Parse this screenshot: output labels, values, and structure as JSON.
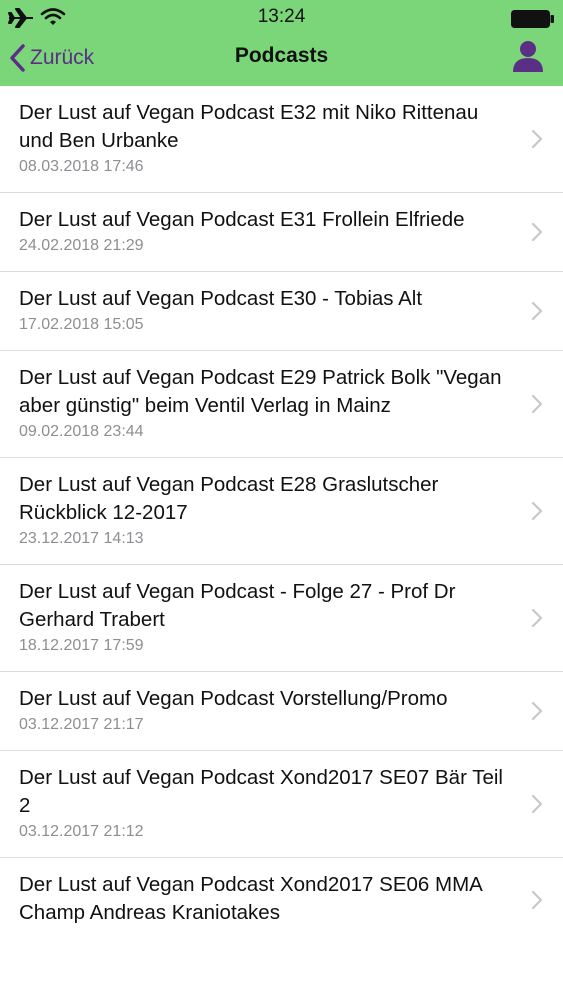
{
  "status_bar": {
    "time": "13:24",
    "icons": [
      "airplane-icon",
      "wifi-icon",
      "battery-icon"
    ]
  },
  "nav": {
    "back_label": "Zurück",
    "title": "Podcasts",
    "profile_icon": "person-icon"
  },
  "colors": {
    "header_bg": "#7bd67a",
    "accent": "#5b2f86",
    "date_text": "#8e8e93",
    "separator": "#dcdcdc",
    "chevron": "#c7c7cc"
  },
  "podcasts": [
    {
      "title": "Der Lust auf Vegan Podcast E32 mit Niko Rittenau und Ben Urbanke",
      "date": "08.03.2018 17:46"
    },
    {
      "title": "Der Lust auf Vegan Podcast E31 Frollein Elfriede",
      "date": "24.02.2018 21:29"
    },
    {
      "title": "Der Lust auf Vegan Podcast E30 - Tobias Alt",
      "date": "17.02.2018 15:05"
    },
    {
      "title": "Der Lust auf Vegan Podcast E29 Patrick Bolk \"Vegan aber günstig\" beim Ventil Verlag in Mainz",
      "date": "09.02.2018 23:44"
    },
    {
      "title": "Der Lust auf Vegan Podcast E28 Graslutscher Rückblick 12-2017",
      "date": "23.12.2017 14:13"
    },
    {
      "title": "Der Lust auf Vegan Podcast - Folge 27 - Prof Dr Gerhard Trabert",
      "date": "18.12.2017 17:59"
    },
    {
      "title": "Der Lust auf Vegan Podcast Vorstellung/Promo",
      "date": "03.12.2017 21:17"
    },
    {
      "title": "Der Lust auf Vegan Podcast Xond2017 SE07 Bär Teil 2",
      "date": "03.12.2017 21:12"
    },
    {
      "title": "Der Lust auf Vegan Podcast Xond2017 SE06 MMA Champ Andreas Kraniotakes",
      "date": ""
    }
  ]
}
